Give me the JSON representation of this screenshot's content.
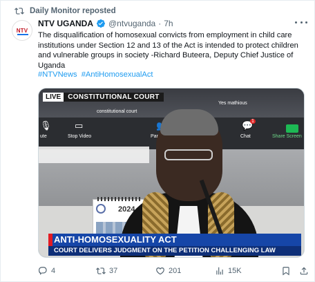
{
  "repost": {
    "label": "Daily Monitor reposted",
    "icon": "repost-icon"
  },
  "author": {
    "avatar_text": "NTV",
    "name": "NTV UGANDA",
    "verified_icon": "verified-badge-icon",
    "handle": "@ntvuganda",
    "separator": "·",
    "time": "7h"
  },
  "tweet": {
    "text": "The disqualification of homosexual convicts from employment in child care institutions under Section 12 and 13 of the Act is intended to protect children and vulnerable groups in society -Richard Buteera, Deputy Chief Justice of Uganda",
    "hashtags": [
      "#NTVNews",
      "#AntiHomosexualAct"
    ]
  },
  "media": {
    "live_label": "LIVE",
    "channel_label": "CONSTITUTIONAL COURT",
    "zoom": {
      "top_names": [
        "constitutional court",
        "Yes mathious"
      ],
      "toolbar": [
        "ute",
        "Stop Video",
        "Participants",
        "Chat",
        "Share Screen"
      ],
      "participants_count": "519",
      "chat_count": "1"
    },
    "calendar_year": "2024",
    "headline": "ANTI-HOMOSEXUALITY ACT",
    "subheadline": "COURT DELIVERS JUDGMENT ON THE PETITION CHALLENGING LAW"
  },
  "actions": {
    "replies": "4",
    "reposts": "37",
    "likes": "201",
    "views": "15K"
  },
  "colors": {
    "link": "#1d9bf0",
    "verified": "#1d9bf0",
    "secondary_text": "#536471",
    "banner_blue": "#1646a8",
    "banner_red": "#e31b23"
  }
}
